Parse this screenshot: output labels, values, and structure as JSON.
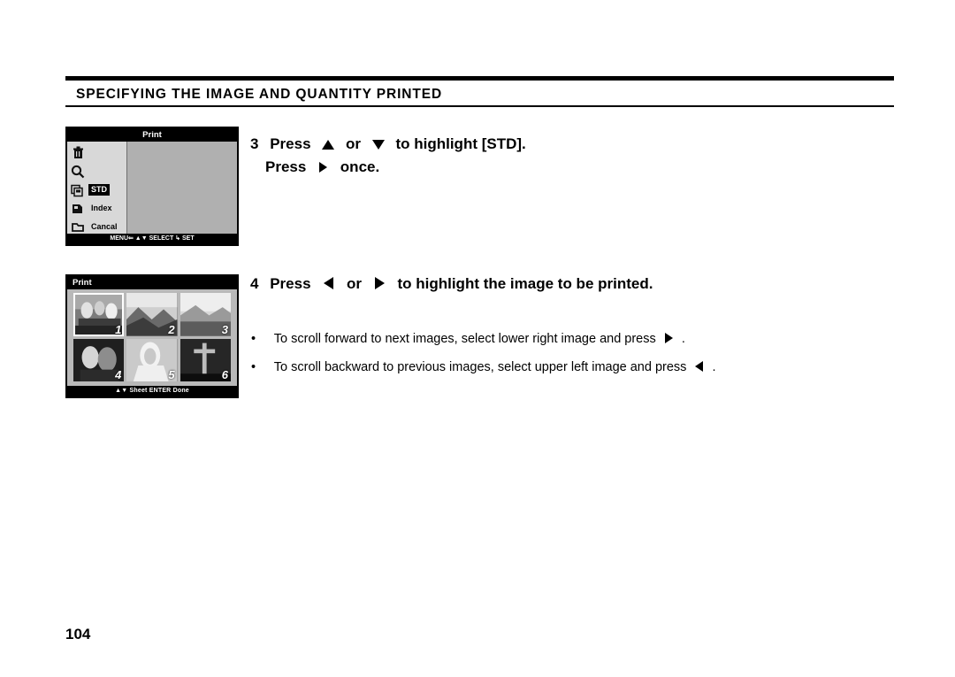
{
  "document": {
    "section_title": "SPECIFYING THE IMAGE AND QUANTITY PRINTED",
    "page_number": "104"
  },
  "steps": {
    "step3": {
      "number": "3",
      "text_a": "Press",
      "text_b": "or",
      "text_c": "to highlight [STD].",
      "line2_a": "Press",
      "line2_b": "once."
    },
    "step4": {
      "number": "4",
      "text_a": "Press",
      "text_b": "or",
      "text_c": "to highlight the image to be printed."
    }
  },
  "bullets": [
    {
      "marker": "•",
      "text": "To scroll forward to next images, select lower right image and press",
      "suffix": "."
    },
    {
      "marker": "•",
      "text": "To scroll backward to previous images, select upper left image and press",
      "suffix": "."
    }
  ],
  "lcd_menu": {
    "title": "Print",
    "items": [
      {
        "label": "",
        "icon": "trash-icon",
        "selected": false
      },
      {
        "label": "",
        "icon": "magnifier-icon",
        "selected": false
      },
      {
        "label": "STD",
        "icon": "multi-print-icon",
        "selected": true
      },
      {
        "label": "Index",
        "icon": "index-print-icon",
        "selected": false
      },
      {
        "label": "Cancal",
        "icon": "folder-icon",
        "selected": false
      }
    ],
    "bottom_bar": "MENU⇐   ▲▼ SELECT   ↳ SET"
  },
  "lcd_thumbs": {
    "title": "Print",
    "thumbnails": [
      {
        "number": "1",
        "selected": true
      },
      {
        "number": "2",
        "selected": false
      },
      {
        "number": "3",
        "selected": false
      },
      {
        "number": "4",
        "selected": false
      },
      {
        "number": "5",
        "selected": false
      },
      {
        "number": "6",
        "selected": false
      }
    ],
    "bottom_bar": "▲▼ Sheet   ENTER Done"
  },
  "colors": {
    "rule": "#000000",
    "lcd_background": "#b9b9b9",
    "lcd_titlebar": "#000000"
  }
}
